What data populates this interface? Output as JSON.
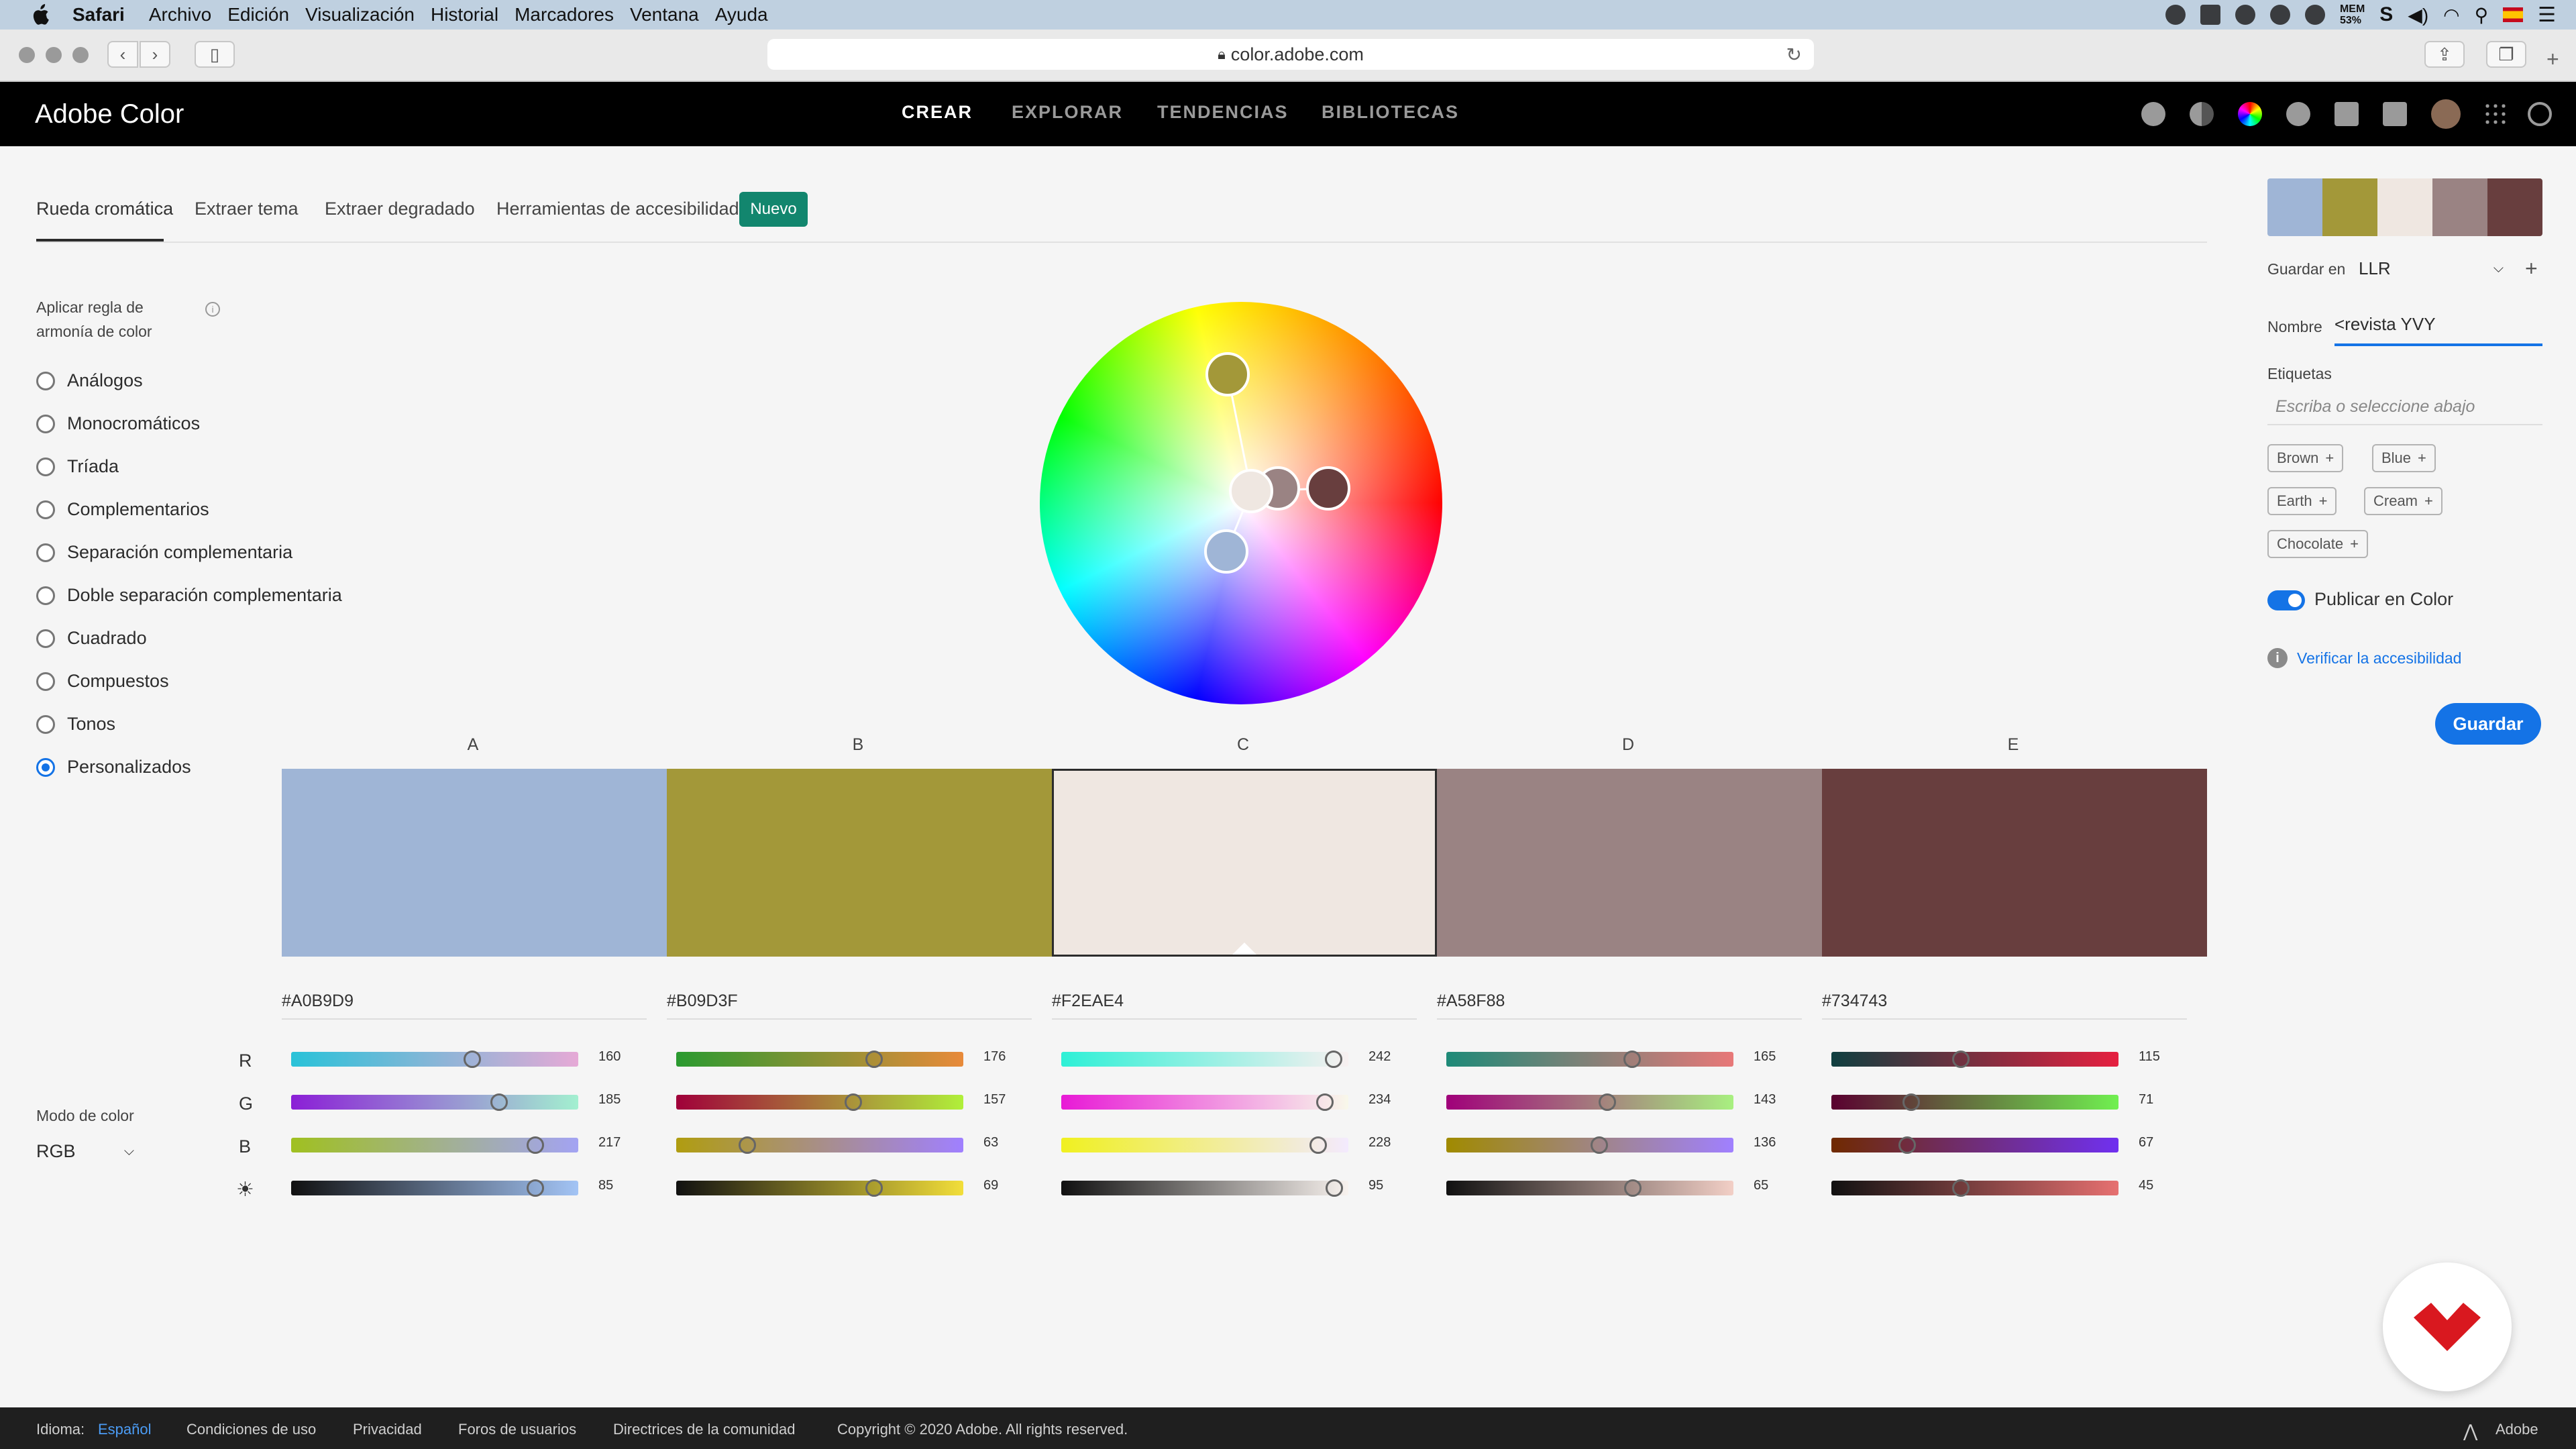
{
  "menubar": {
    "app": "Safari",
    "items": [
      "Archivo",
      "Edición",
      "Visualización",
      "Historial",
      "Marcadores",
      "Ventana",
      "Ayuda"
    ],
    "mem_label": "MEM",
    "mem_value": "53%"
  },
  "browser": {
    "url": "color.adobe.com"
  },
  "app": {
    "brand": "Adobe Color",
    "nav": [
      "CREAR",
      "EXPLORAR",
      "TENDENCIAS",
      "BIBLIOTECAS"
    ],
    "active_nav": "CREAR"
  },
  "tabs": {
    "items": [
      "Rueda cromática",
      "Extraer tema",
      "Extraer degradado",
      "Herramientas de accesibilidad"
    ],
    "badge": "Nuevo"
  },
  "harmony": {
    "title": "Aplicar regla de armonía de color",
    "options": [
      "Análogos",
      "Monocromáticos",
      "Tríada",
      "Complementarios",
      "Separación complementaria",
      "Doble separación complementaria",
      "Cuadrado",
      "Compuestos",
      "Tonos",
      "Personalizados"
    ],
    "selected": "Personalizados"
  },
  "color_mode": {
    "label": "Modo de color",
    "value": "RGB"
  },
  "channels": [
    "R",
    "G",
    "B"
  ],
  "swatches": [
    {
      "label": "A",
      "hex": "#A0B9D9",
      "color": "#9fb5d6",
      "values": [
        "160",
        "185",
        "217",
        "85"
      ],
      "rgb_frac": [
        0.63,
        0.725,
        0.85,
        0.85
      ]
    },
    {
      "label": "B",
      "hex": "#B09D3F",
      "color": "#a39839",
      "values": [
        "176",
        "157",
        "63",
        "69"
      ],
      "rgb_frac": [
        0.69,
        0.616,
        0.247,
        0.69
      ]
    },
    {
      "label": "C",
      "hex": "#F2EAE4",
      "color": "#efe7e1",
      "values": [
        "242",
        "234",
        "228",
        "95"
      ],
      "rgb_frac": [
        0.949,
        0.918,
        0.894,
        0.95
      ]
    },
    {
      "label": "D",
      "hex": "#A58F88",
      "color": "#9a8383",
      "values": [
        "165",
        "143",
        "136",
        "65"
      ],
      "rgb_frac": [
        0.647,
        0.561,
        0.533,
        0.65
      ]
    },
    {
      "label": "E",
      "hex": "#734743",
      "color": "#683e3e",
      "values": [
        "115",
        "71",
        "67",
        "45"
      ],
      "rgb_frac": [
        0.451,
        0.278,
        0.263,
        0.45
      ]
    }
  ],
  "panel": {
    "save_in_label": "Guardar en",
    "library": "LLR",
    "name_label": "Nombre",
    "name_value": "<revista YVY",
    "tags_label": "Etiquetas",
    "tags_placeholder": "Escriba o seleccione abajo",
    "tags": [
      "Brown",
      "Blue",
      "Earth",
      "Cream",
      "Chocolate"
    ],
    "publish_label": "Publicar en Color",
    "publish_on": true,
    "verify_label": "Verificar la accesibilidad",
    "save_button": "Guardar"
  },
  "footer": {
    "idioma_label": "Idioma:",
    "idioma_value": "Español",
    "links": [
      "Condiciones de uso",
      "Privacidad",
      "Foros de usuarios",
      "Directrices de la comunidad"
    ],
    "copyright": "Copyright © 2020 Adobe. All rights reserved.",
    "adobe": "Adobe"
  }
}
